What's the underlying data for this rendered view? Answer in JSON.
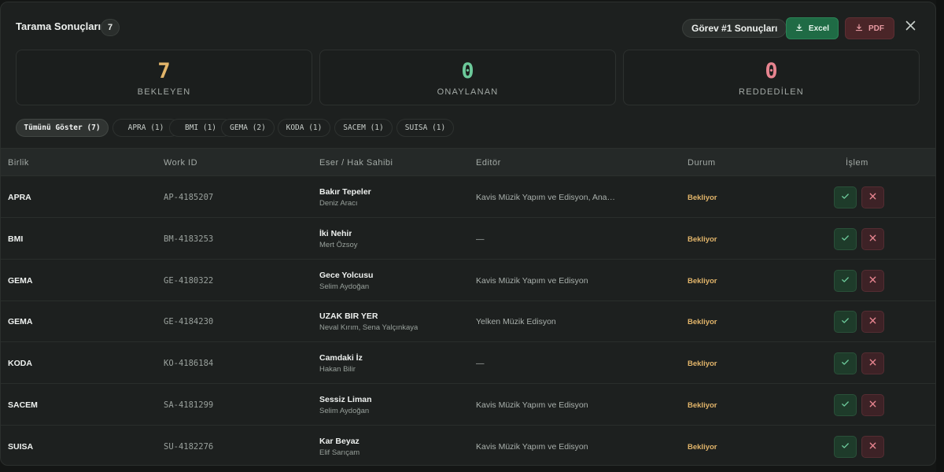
{
  "header": {
    "title": "Tarama Sonuçları",
    "count": "7",
    "task_label": "Görev #1 Sonuçları",
    "excel_label": "Excel",
    "pdf_label": "PDF"
  },
  "stats": [
    {
      "value": "7",
      "label": "BEKLEYEN"
    },
    {
      "value": "0",
      "label": "ONAYLANAN"
    },
    {
      "value": "0",
      "label": "REDDEDİLEN"
    }
  ],
  "filters": [
    {
      "label": "Tümünü Göster (7)",
      "active": true
    },
    {
      "label": "APRA (1)"
    },
    {
      "label": "BMI (1)"
    },
    {
      "label": "GEMA (2)"
    },
    {
      "label": "KODA (1)"
    },
    {
      "label": "SACEM (1)"
    },
    {
      "label": "SUISA (1)"
    }
  ],
  "table": {
    "columns": [
      "Birlik",
      "Work ID",
      "Eser / Hak Sahibi",
      "Editör",
      "Durum",
      "İşlem"
    ],
    "rows": [
      {
        "birlik": "APRA",
        "work_id": "AP-4185207",
        "eser": "Bakır Tepeler",
        "hak_sahibi": "Deniz Aracı",
        "editor": "Kavis Müzik Yapım ve Edisyon, Anad...",
        "durum": "Bekliyor"
      },
      {
        "birlik": "BMI",
        "work_id": "BM-4183253",
        "eser": "İki Nehir",
        "hak_sahibi": "Mert Özsoy",
        "editor": "—",
        "durum": "Bekliyor"
      },
      {
        "birlik": "GEMA",
        "work_id": "GE-4180322",
        "eser": "Gece Yolcusu",
        "hak_sahibi": "Selim Aydoğan",
        "editor": "Kavis Müzik Yapım ve Edisyon",
        "durum": "Bekliyor"
      },
      {
        "birlik": "GEMA",
        "work_id": "GE-4184230",
        "eser": "UZAK BIR YER",
        "hak_sahibi": "Neval Kırım, Sena Yalçınkaya",
        "editor": "Yelken Müzik Edisyon",
        "durum": "Bekliyor"
      },
      {
        "birlik": "KODA",
        "work_id": "KO-4186184",
        "eser": "Camdaki İz",
        "hak_sahibi": "Hakan Bilir",
        "editor": "—",
        "durum": "Bekliyor"
      },
      {
        "birlik": "SACEM",
        "work_id": "SA-4181299",
        "eser": "Sessiz Liman",
        "hak_sahibi": "Selim Aydoğan",
        "editor": "Kavis Müzik Yapım ve Edisyon",
        "durum": "Bekliyor"
      },
      {
        "birlik": "SUISA",
        "work_id": "SU-4182276",
        "eser": "Kar Beyaz",
        "hak_sahibi": "Elif Sarıçam",
        "editor": "Kavis Müzik Yapım ve Edisyon",
        "durum": "Bekliyor"
      }
    ]
  },
  "colors": {
    "pending": "#e2b56a",
    "approved": "#6cc99a",
    "rejected": "#e7848f",
    "excel": "#1f6b45",
    "pdf": "#4a2528"
  }
}
